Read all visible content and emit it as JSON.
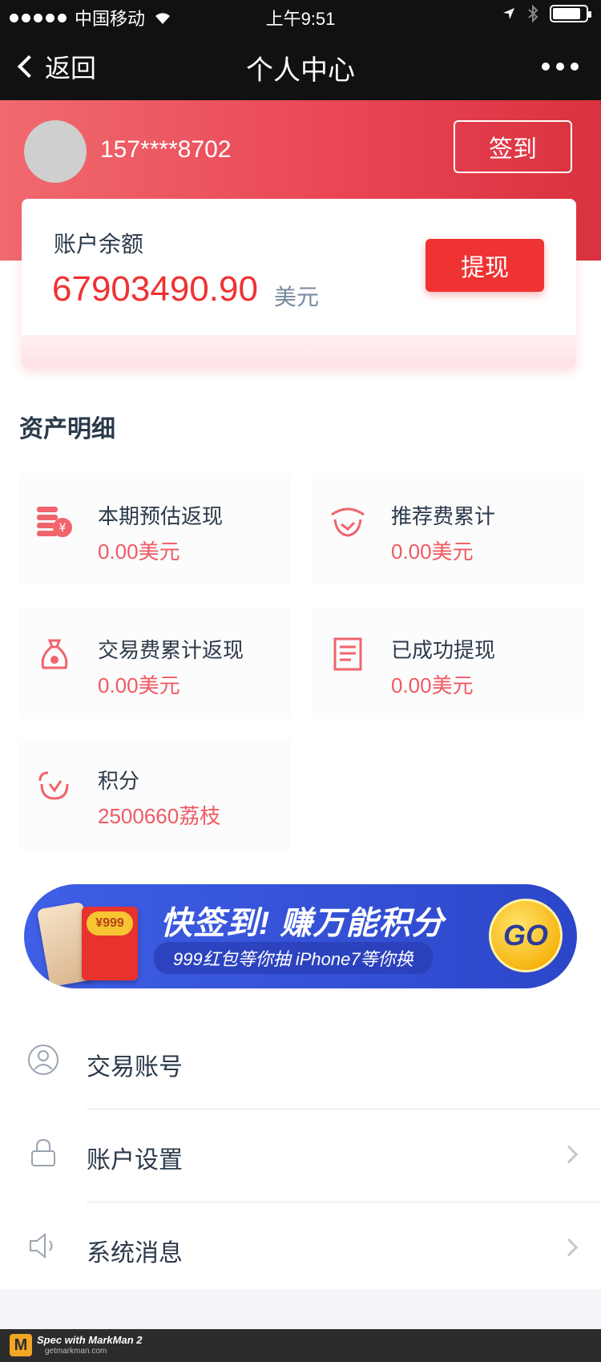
{
  "status_bar": {
    "carrier": "中国移动",
    "time": "上午9:51"
  },
  "nav": {
    "back_label": "返回",
    "title": "个人中心"
  },
  "profile": {
    "phone": "157****8702",
    "checkin_label": "签到"
  },
  "balance": {
    "label": "账户余额",
    "amount": "67903490.90",
    "currency": "美元",
    "withdraw_label": "提现"
  },
  "assets": {
    "title": "资产明细",
    "items": [
      {
        "label": "本期预估返现",
        "value": "0.00美元",
        "icon": "coins-icon"
      },
      {
        "label": "推荐费累计",
        "value": "0.00美元",
        "icon": "handshake-icon"
      },
      {
        "label": "交易费累计返现",
        "value": "0.00美元",
        "icon": "money-bag-icon"
      },
      {
        "label": "已成功提现",
        "value": "0.00美元",
        "icon": "receipt-icon"
      },
      {
        "label": "积分",
        "value": "2500660荔枝",
        "icon": "points-icon"
      }
    ]
  },
  "banner": {
    "coin_text": "¥999",
    "headline": "快签到! 赚万能积分",
    "subline": "999红包等你抽 iPhone7等你换",
    "go_label": "GO"
  },
  "menu": [
    {
      "label": "交易账号",
      "icon": "user-icon"
    },
    {
      "label": "账户设置",
      "icon": "lock-icon"
    },
    {
      "label": "系统消息",
      "icon": "speaker-icon"
    }
  ],
  "watermark": {
    "line1": "Spec with MarkMan 2",
    "line2": "getmarkman.com"
  },
  "colors": {
    "accent_red": "#ef3232",
    "value_red": "#ef5a62",
    "currency_gray": "#788b9e",
    "tile_bg": "#fcfcfc",
    "footer_bg": "#f3f5f8"
  }
}
